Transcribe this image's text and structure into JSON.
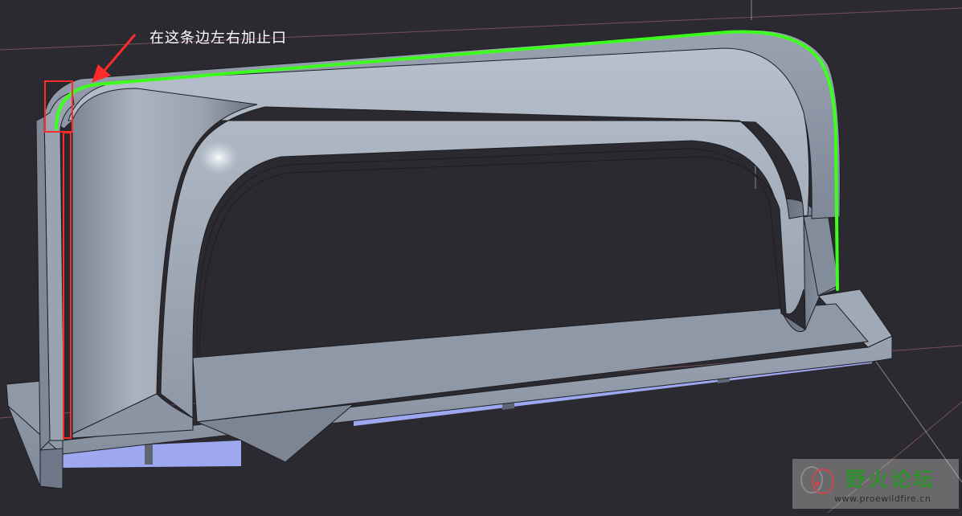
{
  "annotation": {
    "text": "在这条边左右加止口"
  },
  "watermark": {
    "title": "野火论坛",
    "url": "www.proewildfire.cn"
  },
  "colors": {
    "background": "#2b2a31",
    "part_light": "#a9b2bf",
    "part_mid": "#8b95a4",
    "part_dark": "#5e6674",
    "underside_blue": "#9ea8f0",
    "highlight_edge": "#3dff1e",
    "annotation_red": "#ff2a2a",
    "grid_line": "#8a5a5e"
  },
  "icons": {
    "watermark_logo": "butterfly-logo-icon",
    "pointer": "red-arrow-icon"
  }
}
